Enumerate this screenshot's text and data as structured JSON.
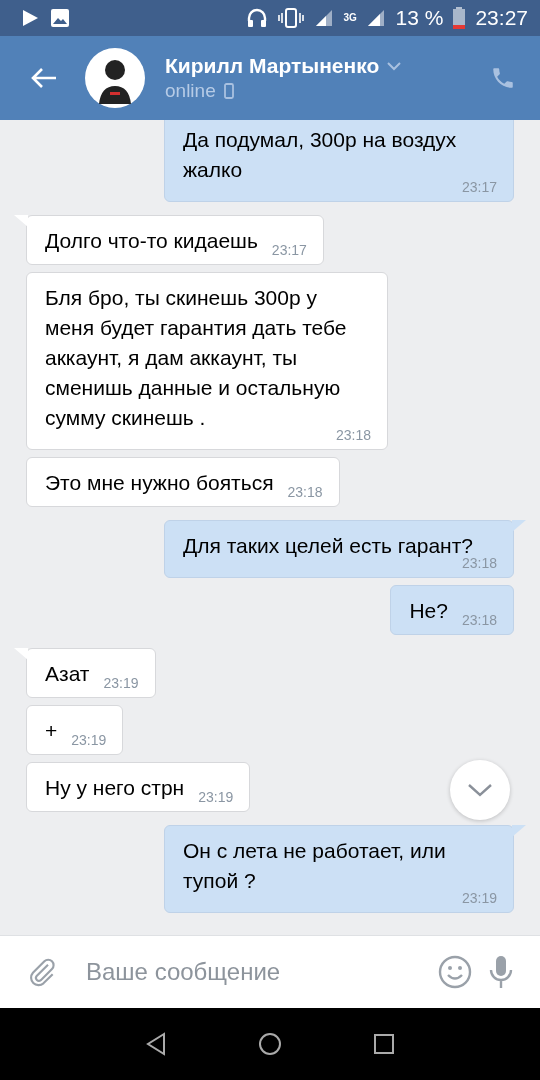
{
  "status_bar": {
    "battery": "13 %",
    "time": "23:27",
    "network": "3G"
  },
  "header": {
    "name": "Кирилл Мартыненко",
    "presence": "online"
  },
  "messages": [
    {
      "kind": "outgoing",
      "text": "Да подумал, 300р на воздух жалко",
      "time": "23:17"
    },
    {
      "kind": "incoming",
      "text": "Долго что-то кидаешь",
      "time": "23:17",
      "tail": true
    },
    {
      "kind": "incoming",
      "text": "Бля бро, ты скинешь 300р у меня будет гарантия дать тебе аккаунт, я дам аккаунт, ты сменишь данные и остальную сумму скинешь .",
      "time": "23:18",
      "tail": false
    },
    {
      "kind": "incoming",
      "text": "Это мне нужно бояться",
      "time": "23:18",
      "tail": false
    },
    {
      "kind": "outgoing",
      "text": "Для таких целей есть гарант?",
      "time": "23:18",
      "tail": true
    },
    {
      "kind": "outgoing",
      "text": "Не?",
      "time": "23:18",
      "tail": false
    },
    {
      "kind": "incoming",
      "text": "Азат",
      "time": "23:19",
      "tail": true
    },
    {
      "kind": "incoming",
      "text": "+",
      "time": "23:19",
      "tail": false
    },
    {
      "kind": "incoming",
      "text": "Ну у него стрн",
      "time": "23:19",
      "tail": false
    },
    {
      "kind": "outgoing",
      "text": "Он с лета не работает, или тупой ?",
      "time": "23:19",
      "tail": true
    }
  ],
  "composer": {
    "placeholder": "Ваше сообщение"
  }
}
